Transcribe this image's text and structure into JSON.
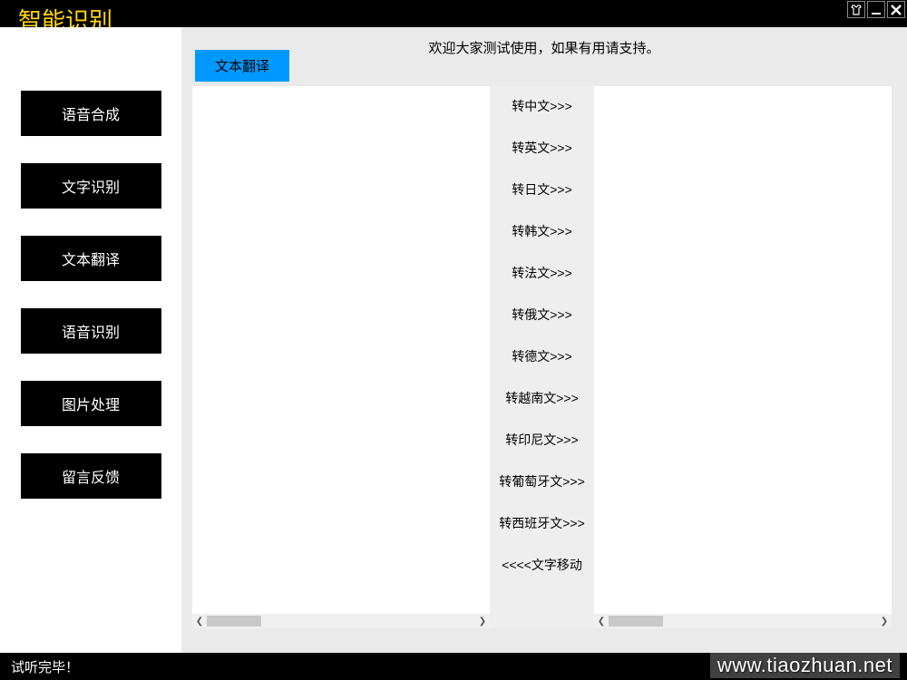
{
  "app": {
    "title": "智能识别"
  },
  "header": {
    "welcome": "欢迎大家测试使用，如果有用请支持。"
  },
  "sidebar": {
    "items": [
      {
        "label": "语音合成"
      },
      {
        "label": "文字识别"
      },
      {
        "label": "文本翻译"
      },
      {
        "label": "语音识别"
      },
      {
        "label": "图片处理"
      },
      {
        "label": "留言反馈"
      }
    ]
  },
  "tab": {
    "active": "文本翻译"
  },
  "languages": [
    "转中文>>>",
    "转英文>>>",
    "转日文>>>",
    "转韩文>>>",
    "转法文>>>",
    "转俄文>>>",
    "转德文>>>",
    "转越南文>>>",
    "转印尼文>>>",
    "转葡萄牙文>>>",
    "转西班牙文>>>",
    "<<<<文字移动"
  ],
  "status": {
    "text": "试听完毕！"
  },
  "watermark": "www.tiaozhuan.net"
}
